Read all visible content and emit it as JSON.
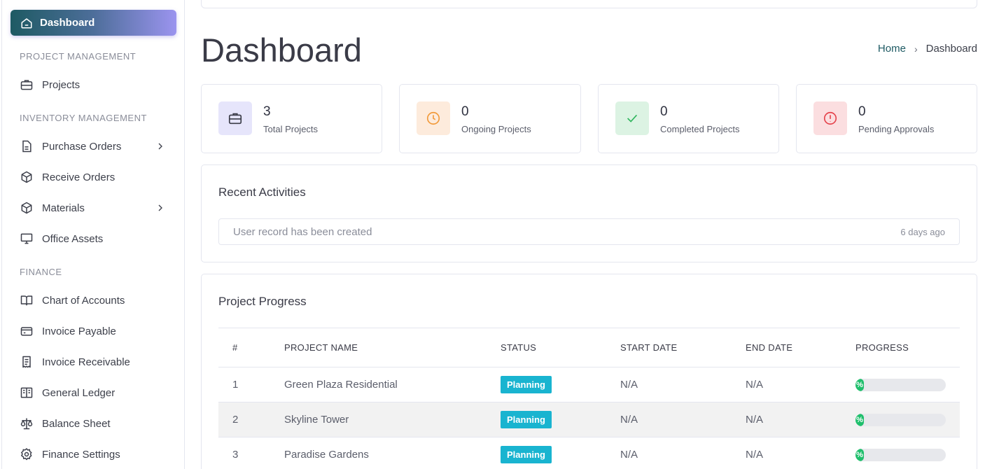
{
  "sidebar": {
    "active": {
      "label": "Dashboard",
      "icon": "home-icon"
    },
    "sections": [
      {
        "title": "PROJECT MANAGEMENT",
        "items": [
          {
            "label": "Projects",
            "icon": "briefcase-icon"
          }
        ]
      },
      {
        "title": "INVENTORY MANAGEMENT",
        "items": [
          {
            "label": "Purchase Orders",
            "icon": "file-icon",
            "has_submenu": true
          },
          {
            "label": "Receive Orders",
            "icon": "box-icon"
          },
          {
            "label": "Materials",
            "icon": "box-icon",
            "has_submenu": true
          },
          {
            "label": "Office Assets",
            "icon": "monitor-icon"
          }
        ]
      },
      {
        "title": "FINANCE",
        "items": [
          {
            "label": "Chart of Accounts",
            "icon": "book-icon"
          },
          {
            "label": "Invoice Payable",
            "icon": "credit-card-icon"
          },
          {
            "label": "Invoice Receivable",
            "icon": "receipt-icon"
          },
          {
            "label": "General Ledger",
            "icon": "ledger-icon"
          },
          {
            "label": "Balance Sheet",
            "icon": "scale-icon"
          },
          {
            "label": "Finance Settings",
            "icon": "gear-icon"
          }
        ]
      }
    ]
  },
  "page": {
    "title": "Dashboard",
    "breadcrumb": {
      "home": "Home",
      "current": "Dashboard"
    }
  },
  "stats": [
    {
      "value": "3",
      "label": "Total Projects",
      "icon": "briefcase-icon",
      "color": "#5b5fc7",
      "bg": "#e6e5fb"
    },
    {
      "value": "0",
      "label": "Ongoing Projects",
      "icon": "clock-icon",
      "color": "#f29a3a",
      "bg": "#fdebdc"
    },
    {
      "value": "0",
      "label": "Completed Projects",
      "icon": "check-icon",
      "color": "#2fb55d",
      "bg": "#dcf3e3"
    },
    {
      "value": "0",
      "label": "Pending Approvals",
      "icon": "alert-circle-icon",
      "color": "#e5434c",
      "bg": "#fbdee0"
    }
  ],
  "activities": {
    "title": "Recent Activities",
    "items": [
      {
        "text": "User record has been created",
        "time": "6 days ago"
      }
    ]
  },
  "progress": {
    "title": "Project Progress",
    "columns": [
      "#",
      "PROJECT NAME",
      "STATUS",
      "START DATE",
      "END DATE",
      "PROGRESS"
    ],
    "rows": [
      {
        "num": "1",
        "name": "Green Plaza Residential",
        "status": "Planning",
        "start": "N/A",
        "end": "N/A",
        "progress_label": "%",
        "progress": 0
      },
      {
        "num": "2",
        "name": "Skyline Tower",
        "status": "Planning",
        "start": "N/A",
        "end": "N/A",
        "progress_label": "%",
        "progress": 0
      },
      {
        "num": "3",
        "name": "Paradise Gardens",
        "status": "Planning",
        "start": "N/A",
        "end": "N/A",
        "progress_label": "%",
        "progress": 0
      }
    ]
  },
  "colors": {
    "accent": "#1e5a63",
    "badge": "#19b4d0",
    "progress": "#1fbf6c"
  }
}
